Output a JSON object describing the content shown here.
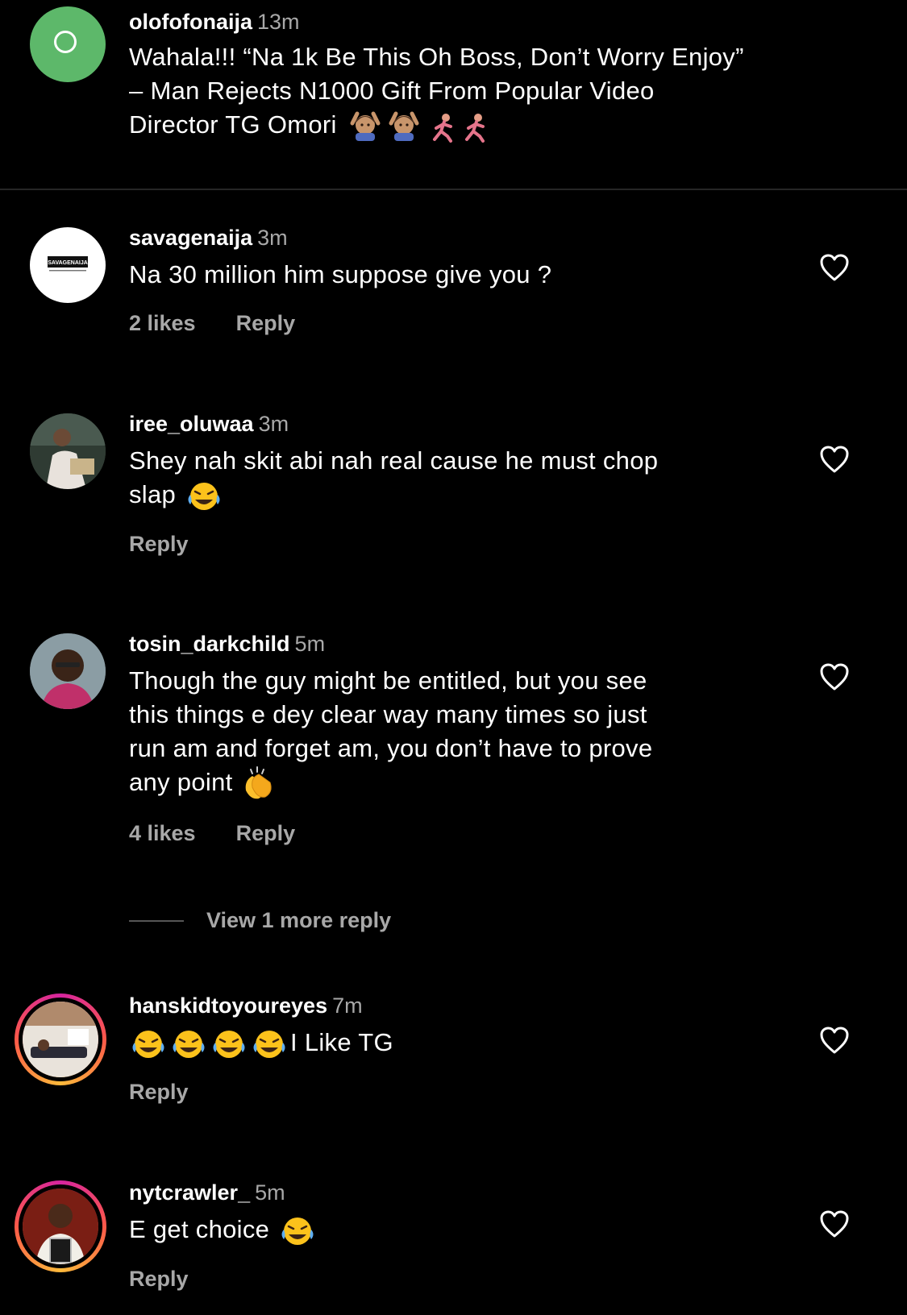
{
  "caption": {
    "username": "olofofonaija",
    "time": "13m",
    "lines": [
      "Wahala!!! “Na 1k Be This Oh Boss, Don’t Worry Enjoy”",
      "– Man Rejects N1000 Gift From Popular Video",
      "Director TG Omori"
    ],
    "emojis": [
      "person-gesturing-ok-emoji",
      "person-gesturing-ok-emoji",
      "person-running-emoji",
      "person-running-emoji"
    ]
  },
  "comments": [
    {
      "username": "savagenaija",
      "time": "3m",
      "text_lines": [
        "Na 30 million him suppose give you ?"
      ],
      "likes": "2 likes",
      "reply": "Reply",
      "avatar_text": "SAVAGENAIJA"
    },
    {
      "username": "iree_oluwaa",
      "time": "3m",
      "text_lines": [
        "Shey nah skit abi nah real cause he must chop",
        "slap"
      ],
      "reply": "Reply"
    },
    {
      "username": "tosin_darkchild",
      "time": "5m",
      "text_lines": [
        "Though the guy might be entitled, but you see",
        "this things e dey clear way many times so just",
        "run am and forget am, you don’t have to prove",
        "any point"
      ],
      "likes": "4 likes",
      "reply": "Reply"
    },
    {
      "username": "hanskidtoyoureyes",
      "time": "7m",
      "text_lines": [
        "I Like TG"
      ],
      "reply": "Reply"
    },
    {
      "username": "nytcrawler_",
      "time": "5m",
      "text_lines": [
        "E get choice"
      ],
      "reply": "Reply"
    }
  ],
  "view_more": "View 1 more reply",
  "colors": {
    "background": "#000000",
    "text": "#ffffff",
    "secondary": "#a8a8a8",
    "caption_avatar": "#5db86a"
  }
}
